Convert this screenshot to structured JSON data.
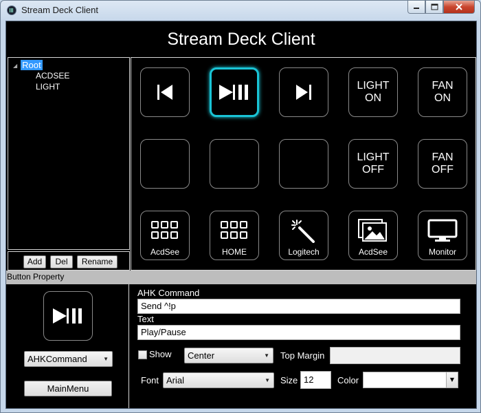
{
  "window": {
    "title": "Stream Deck Client"
  },
  "header": {
    "title": "Stream Deck Client"
  },
  "tree": {
    "root": "Root",
    "children": [
      "ACDSEE",
      "LIGHT"
    ],
    "buttons": {
      "add": "Add",
      "del": "Del",
      "rename": "Rename"
    }
  },
  "keys": [
    {
      "icon": "skip-previous-icon",
      "label": ""
    },
    {
      "icon": "play-pause-icon",
      "label": "",
      "active": true
    },
    {
      "icon": "skip-next-icon",
      "label": ""
    },
    {
      "icon": "",
      "label": "LIGHT ON"
    },
    {
      "icon": "",
      "label": "FAN ON"
    },
    {
      "icon": "",
      "label": ""
    },
    {
      "icon": "",
      "label": ""
    },
    {
      "icon": "",
      "label": ""
    },
    {
      "icon": "",
      "label": "LIGHT OFF"
    },
    {
      "icon": "",
      "label": "FAN OFF"
    },
    {
      "icon": "apps-grid-icon",
      "label": "AcdSee"
    },
    {
      "icon": "apps-grid-icon",
      "label": "HOME"
    },
    {
      "icon": "magic-wand-icon",
      "label": "Logitech"
    },
    {
      "icon": "images-icon",
      "label": "AcdSee"
    },
    {
      "icon": "monitor-icon",
      "label": "Monitor"
    }
  ],
  "property": {
    "section_title": "Button Property",
    "preview_icon": "play-pause-icon",
    "type_select": "AHKCommand",
    "main_menu": "MainMenu",
    "ahk_label": "AHK Command",
    "ahk_value": "Send ^!p",
    "text_label": "Text",
    "text_value": "Play/Pause",
    "show_label": "Show",
    "show_checked": false,
    "align_select": "Center",
    "top_margin_label": "Top Margin",
    "top_margin_value": "",
    "font_label": "Font",
    "font_select": "Arial",
    "size_label": "Size",
    "size_value": "12",
    "color_label": "Color",
    "color_value": ""
  },
  "colors": {
    "accent": "#19c4d6",
    "selection": "#3399ff",
    "background": "#000000"
  }
}
